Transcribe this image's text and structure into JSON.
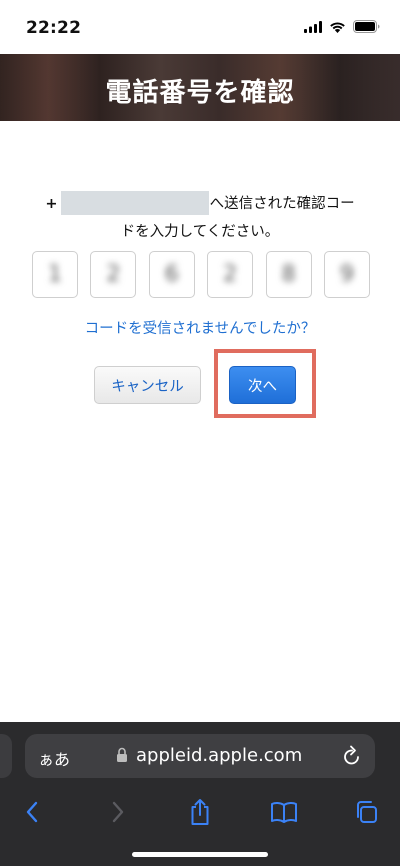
{
  "status_bar": {
    "time": "22:22"
  },
  "header": {
    "title": "電話番号を確認"
  },
  "message": {
    "prefix": "+",
    "line1_suffix": "へ送信された確認コー",
    "line2": "ドを入力してください。"
  },
  "code_digits": [
    "1",
    "2",
    "6",
    "2",
    "8",
    "9"
  ],
  "resend_link": "コードを受信されませんでしたか？",
  "buttons": {
    "cancel": "キャンセル",
    "next": "次へ"
  },
  "browser": {
    "aa_label": "ぁあ",
    "url": "appleid.apple.com"
  },
  "colors": {
    "link": "#1f6fd1",
    "primary_button": "#1f6fd8",
    "highlight": "#e06c5e",
    "toolbar": "#2b2b2d"
  }
}
